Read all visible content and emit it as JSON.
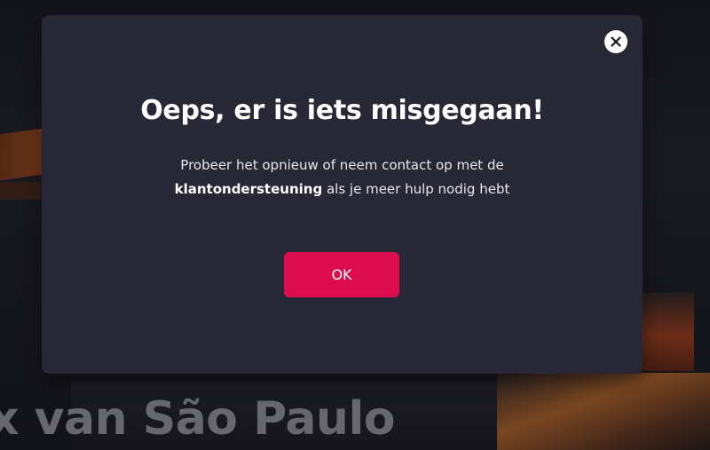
{
  "background": {
    "hero_title": "x van São Paulo"
  },
  "modal": {
    "title": "Oeps, er is iets misgegaan!",
    "body_line1": "Probeer het opnieuw of neem contact op met de",
    "body_link": "klantondersteuning",
    "body_line2_rest": " als je meer hulp nodig hebt",
    "ok_label": "OK",
    "close_icon": "close-icon"
  },
  "colors": {
    "modal_background": "#272735",
    "primary_button": "#dc0c4e",
    "close_button_background": "#ffffff",
    "title_text": "#ffffff"
  }
}
